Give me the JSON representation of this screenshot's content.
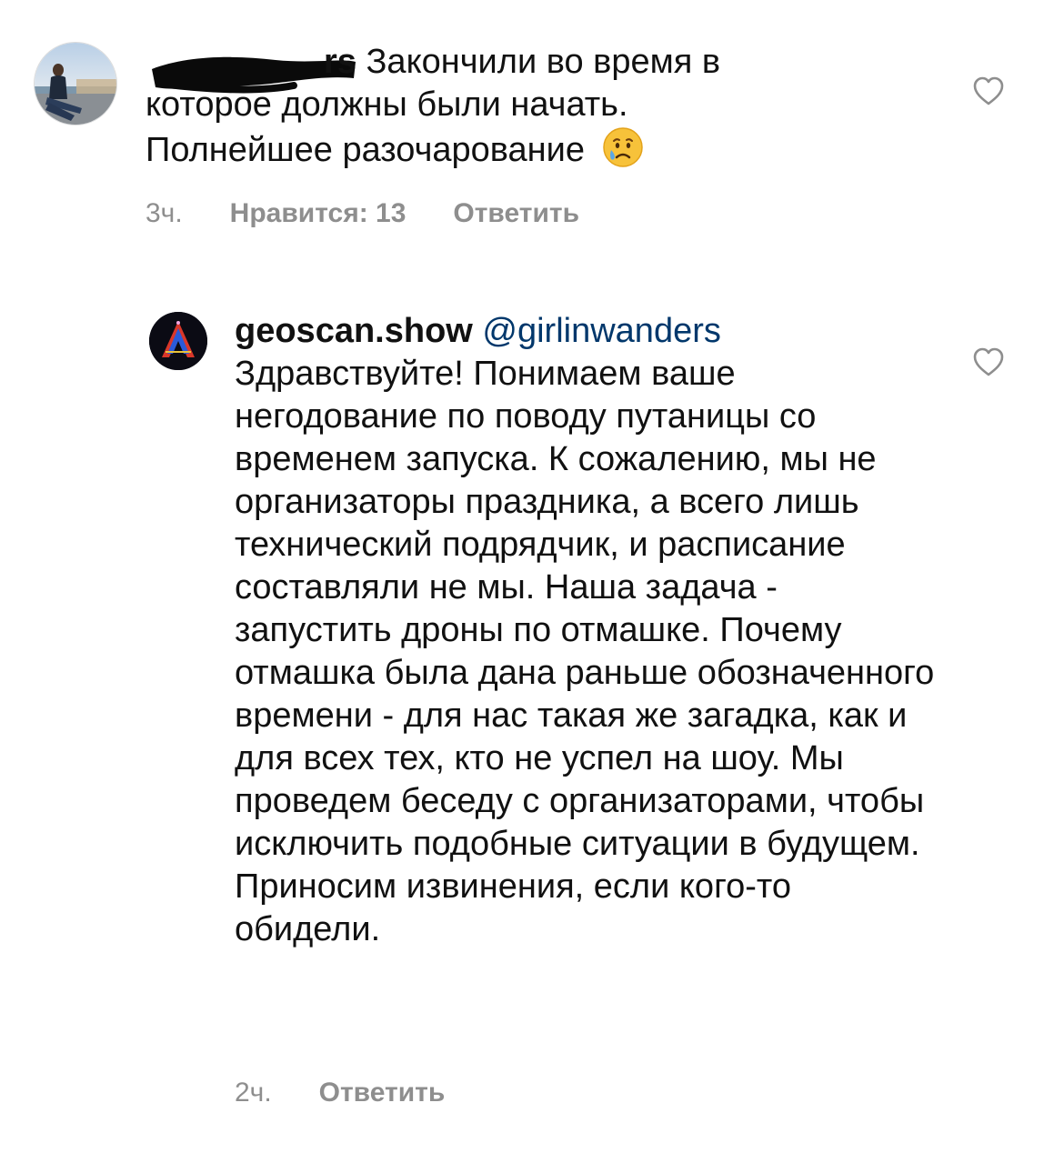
{
  "comments": [
    {
      "username_visible": "rs",
      "text": "Закончили во время в которое должны были начать. Полнейшее разочарование",
      "emoji_icon": "crying-face-icon",
      "time": "3ч.",
      "likes_label": "Нравится: 13",
      "reply_label": "Ответить"
    },
    {
      "username": "geoscan.show",
      "mention": "@girlinwanders",
      "text": "Здравствуйте! Понимаем ваше негодование по поводу путаницы со временем запуска. К сожалению, мы не организаторы праздника, а всего лишь технический подрядчик, и расписание составляли не мы. Наша задача - запустить дроны по отмашке. Почему отмашка была дана раньше обозначенного времени - для нас такая же загадка, как и для всех тех, кто не успел на шоу. Мы проведем беседу с организаторами, чтобы исключить подобные ситуации в будущем. Приносим извинения, если кого-то обидели.",
      "time": "2ч.",
      "reply_label": "Ответить"
    }
  ],
  "icons": {
    "like": "heart-outline-icon",
    "avatar_1": "user-avatar-photo",
    "avatar_2": "geoscan-logo-avatar"
  },
  "colors": {
    "text": "#111111",
    "meta": "#8e8e8e",
    "mention": "#00376b",
    "heart_stroke": "#8e8e8e"
  }
}
